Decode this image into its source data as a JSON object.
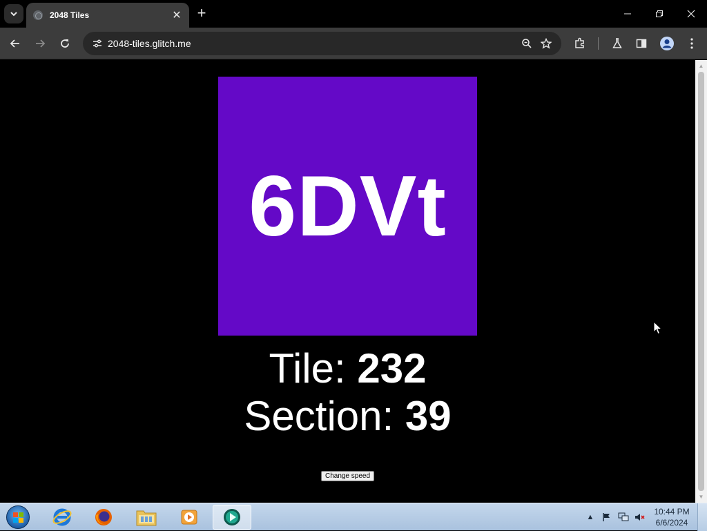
{
  "browser": {
    "tab": {
      "title": "2048 Tiles",
      "close_glyph": "✕"
    },
    "new_tab_glyph": "+",
    "url": "2048-tiles.glitch.me",
    "window_controls": {
      "minimize": "—",
      "restore": "❐",
      "close": "✕"
    }
  },
  "page": {
    "tile": {
      "text": "6DVt",
      "color": "#6409c7"
    },
    "tile_label": "Tile: ",
    "tile_number": "232",
    "section_label": "Section: ",
    "section_number": "39",
    "change_speed_label": "Change speed"
  },
  "taskbar": {
    "apps": [
      "internet-explorer",
      "firefox",
      "file-explorer",
      "media-player",
      "active-app"
    ],
    "clock_time": "10:44 PM",
    "clock_date": "6/6/2024"
  }
}
